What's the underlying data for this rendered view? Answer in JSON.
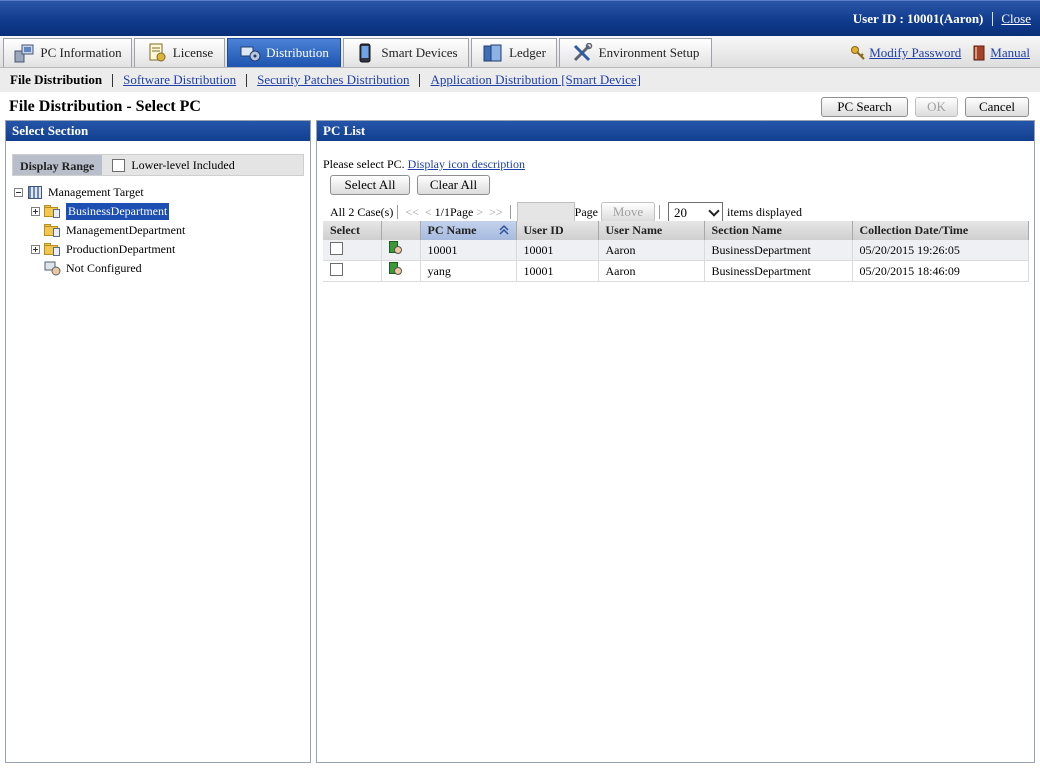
{
  "header": {
    "user_label": "User ID : 10001(Aaron)",
    "close_label": "Close"
  },
  "tabs": [
    {
      "label": "PC Information",
      "icon": "pc-info-icon",
      "active": false
    },
    {
      "label": "License",
      "icon": "license-icon",
      "active": false
    },
    {
      "label": "Distribution",
      "icon": "distribution-icon",
      "active": true
    },
    {
      "label": "Smart Devices",
      "icon": "smart-device-icon",
      "active": false
    },
    {
      "label": "Ledger",
      "icon": "ledger-icon",
      "active": false
    },
    {
      "label": "Environment Setup",
      "icon": "tools-icon",
      "active": false
    }
  ],
  "top_links": {
    "modify_password": "Modify Password",
    "manual": "Manual"
  },
  "subnav": {
    "current": "File Distribution",
    "links": [
      "Software Distribution",
      "Security Patches Distribution",
      "Application Distribution [Smart Device]"
    ]
  },
  "page": {
    "title": "File Distribution - Select PC",
    "buttons": {
      "pc_search": "PC Search",
      "ok": "OK",
      "cancel": "Cancel"
    }
  },
  "left_panel": {
    "title": "Select Section",
    "display_range_label": "Display Range",
    "lower_level_label": "Lower-level Included",
    "lower_level_checked": false,
    "tree": {
      "root": "Management Target",
      "children": [
        {
          "label": "BusinessDepartment",
          "expandable": true,
          "selected": true
        },
        {
          "label": "ManagementDepartment",
          "expandable": false,
          "selected": false
        },
        {
          "label": "ProductionDepartment",
          "expandable": true,
          "selected": false
        },
        {
          "label": "Not Configured",
          "expandable": false,
          "selected": false
        }
      ]
    }
  },
  "right_panel": {
    "title": "PC List",
    "hint_text": "Please select PC.",
    "hint_link": "Display icon description",
    "select_all": "Select All",
    "clear_all": "Clear All",
    "pager": {
      "count": "All 2 Case(s)",
      "first": "<<",
      "prev": "<",
      "page_info": "1/1Page",
      "next": ">",
      "last": ">>",
      "page_input": "",
      "page_label": "Page",
      "move": "Move",
      "per_page": "20",
      "items_label": "items displayed"
    },
    "columns": [
      "Select",
      "",
      "PC Name",
      "User ID",
      "User Name",
      "Section Name",
      "Collection Date/Time"
    ],
    "rows": [
      {
        "pc_name": "10001",
        "user_id": "10001",
        "user_name": "Aaron",
        "section": "BusinessDepartment",
        "collected": "05/20/2015 19:26:05"
      },
      {
        "pc_name": "yang",
        "user_id": "10001",
        "user_name": "Aaron",
        "section": "BusinessDepartment",
        "collected": "05/20/2015 18:46:09"
      }
    ]
  }
}
